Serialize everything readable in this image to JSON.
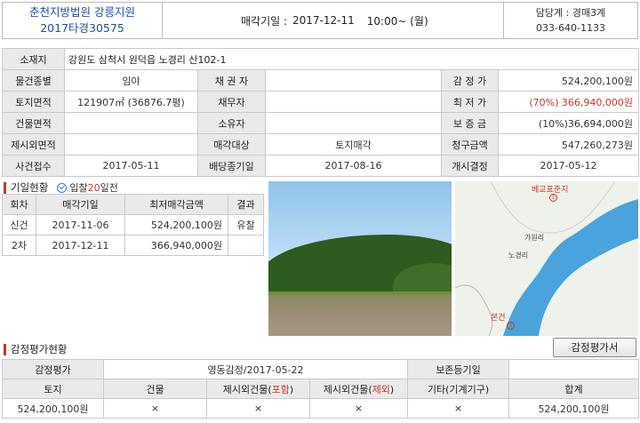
{
  "header": {
    "court": "춘천지방법원 강릉지원",
    "case_no": "2017타경30575",
    "date_label": "매각기일 :",
    "date_value": "2017-12-11",
    "time_value": "10:00~ (월)",
    "dept": "담당계 : 경매3계",
    "phone": "033-640-1133"
  },
  "info": {
    "address_label": "소재지",
    "address": "강원도 삼척시 원덕읍 노경리 산102-1",
    "type_label": "물건종별",
    "type": "임야",
    "creditor_label": "채 권 자",
    "creditor": "",
    "appraisal_label": "감 정 가",
    "appraisal": "524,200,100원",
    "land_label": "토지면적",
    "land": "121907㎡ (36876.7평)",
    "debtor_label": "채무자",
    "debtor": "",
    "min_label": "최 저 가",
    "min_pct": "(70%)",
    "min_value": "366,940,000원",
    "bldg_label": "건물면적",
    "bldg": "",
    "owner_label": "소유자",
    "owner": "",
    "deposit_label": "보 증 금",
    "deposit": "(10%)36,694,000원",
    "excl_label": "제시외면적",
    "excl": "",
    "target_label": "매각대상",
    "target": "토지매각",
    "claim_label": "청구금액",
    "claim": "547,260,273원",
    "filed_label": "사건접수",
    "filed": "2017-05-11",
    "dividend_label": "배당종기일",
    "dividend": "2017-08-16",
    "start_label": "개시결정",
    "start": "2017-05-12"
  },
  "history": {
    "title": "기일현황",
    "note_prefix": "입찰",
    "note_days": "20",
    "note_suffix": "일전",
    "headers": [
      "회차",
      "매각기일",
      "최저매각금액",
      "결과"
    ],
    "rows": [
      {
        "round": "신건",
        "date": "2017-11-06",
        "price": "524,200,100원",
        "result": "유찰"
      },
      {
        "round": "2차",
        "date": "2017-12-11",
        "price": "366,940,000원",
        "result": ""
      }
    ]
  },
  "map": {
    "label_top": "베교표준지",
    "label_mid": "노경리",
    "label_side": "가원리",
    "label_bottom": "본건",
    "circle": "1"
  },
  "appraisal": {
    "title": "감정평가현황",
    "button": "감정평가서",
    "row1": {
      "label": "감정평가",
      "value": "영동감정/2017-05-22",
      "keep_label": "보존등기일",
      "keep_value": ""
    },
    "headers": {
      "land": "토지",
      "building": "건물",
      "incl_a": "제시외건물(",
      "incl_b": "포함",
      "incl_c": ")",
      "excl_a": "제시외건물(",
      "excl_b": "제외",
      "excl_c": ")",
      "etc": "기타(기계기구)",
      "total": "합계"
    },
    "values": {
      "land": "524,200,100원",
      "building": "×",
      "incl": "×",
      "excl": "×",
      "etc": "×",
      "total": "524,200,100원"
    }
  }
}
